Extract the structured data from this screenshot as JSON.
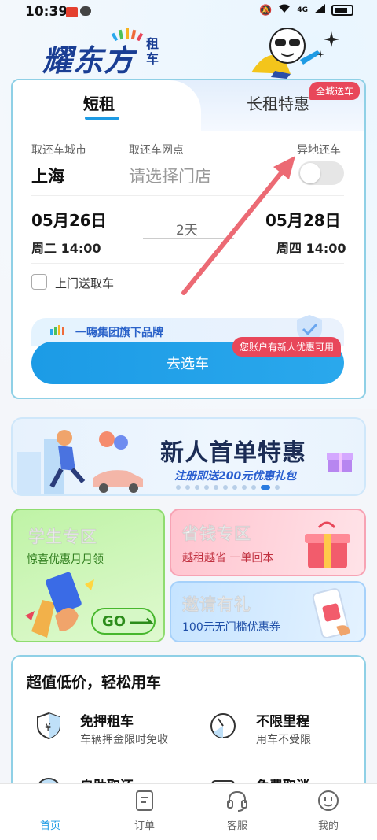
{
  "status_bar": {
    "time": "10:39",
    "network": "4G"
  },
  "brand": {
    "logo_text": "耀东方",
    "logo_suffix": "租车"
  },
  "tabs": [
    {
      "label": "短租",
      "active": true
    },
    {
      "label": "长租特惠",
      "active": false
    }
  ],
  "badge_city_return": "全城送车",
  "form": {
    "city_label": "取还车城市",
    "city_value": "上海",
    "store_label": "取还车网点",
    "store_placeholder": "请选择门店",
    "diff_return_label": "异地还车",
    "pickup_date": "05月26日",
    "pickup_time": "周二 14:00",
    "duration": "2天",
    "return_date": "05月28日",
    "return_time": "周四 14:00",
    "door_service_label": "上门送取车"
  },
  "group_brand": "一嗨集团旗下品牌",
  "new_user_tip": "您账户有新人优惠可用",
  "search_button": "去选车",
  "banner": {
    "title": "新人首单特惠",
    "subtitle": "注册即送200元优惠礼包"
  },
  "tiles": {
    "student": {
      "title": "学生专区",
      "subtitle": "惊喜优惠月月领",
      "go": "GO"
    },
    "save": {
      "title": "省钱专区",
      "subtitle": "越租越省 一单回本"
    },
    "invite": {
      "title": "邀请有礼",
      "subtitle": "100元无门槛优惠券"
    }
  },
  "value_section": {
    "title": "超值低价，轻松用车",
    "features": [
      {
        "title": "免押租车",
        "subtitle": "车辆押金限时免收",
        "icon": "shield-yuan-icon"
      },
      {
        "title": "不限里程",
        "subtitle": "用车不受限",
        "icon": "speedometer-icon"
      },
      {
        "title": "自助取还",
        "icon": "self-service-icon"
      },
      {
        "title": "免费取消",
        "icon": "free-cancel-icon"
      }
    ]
  },
  "bottom_nav": [
    {
      "label": "首页",
      "icon": "home-icon",
      "active": true
    },
    {
      "label": "订单",
      "icon": "order-icon",
      "active": false
    },
    {
      "label": "客服",
      "icon": "headset-icon",
      "active": false
    },
    {
      "label": "我的",
      "icon": "profile-icon",
      "active": false
    }
  ],
  "colors": {
    "primary": "#1e9be4",
    "brand": "#1a3e94",
    "badge": "#e8475a"
  }
}
